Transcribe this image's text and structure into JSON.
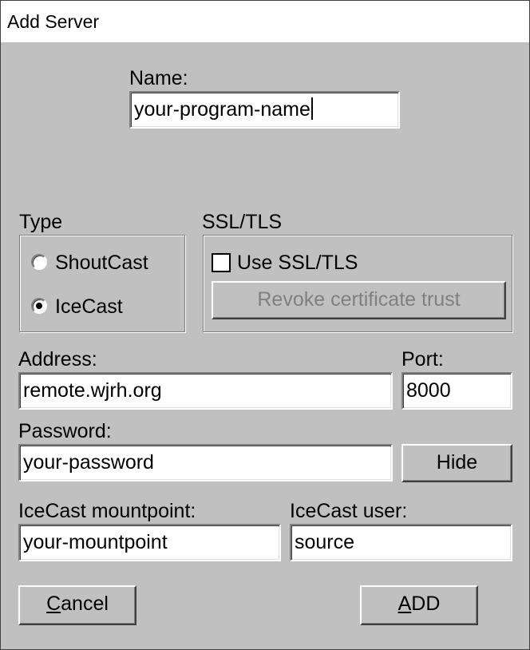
{
  "window": {
    "title": "Add Server"
  },
  "name": {
    "label": "Name:",
    "value": "your-program-name"
  },
  "type": {
    "label": "Type",
    "options": [
      {
        "label": "ShoutCast",
        "selected": false
      },
      {
        "label": "IceCast",
        "selected": true
      }
    ]
  },
  "ssl": {
    "label": "SSL/TLS",
    "checkbox_label": "Use SSL/TLS",
    "checked": false,
    "revoke_label": "Revoke certificate trust"
  },
  "address": {
    "label": "Address:",
    "value": "remote.wjrh.org"
  },
  "port": {
    "label": "Port:",
    "value": "8000"
  },
  "password": {
    "label": "Password:",
    "value": "your-password",
    "toggle_label": "Hide"
  },
  "mountpoint": {
    "label": "IceCast mountpoint:",
    "value": "your-mountpoint"
  },
  "user": {
    "label": "IceCast user:",
    "value": "source"
  },
  "buttons": {
    "cancel_first": "C",
    "cancel_rest": "ancel",
    "add_first": "A",
    "add_rest": "DD"
  }
}
